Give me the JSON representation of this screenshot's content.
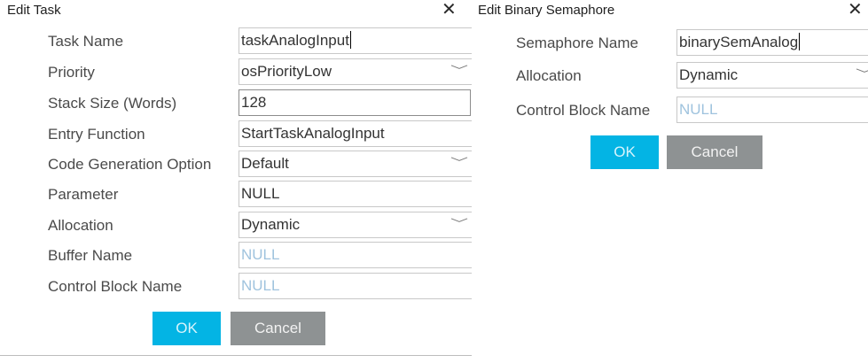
{
  "task_dialog": {
    "title": "Edit Task",
    "close_glyph": "✕",
    "rows": [
      {
        "label": "Task Name",
        "value": "taskAnalogInput",
        "kind": "text-active"
      },
      {
        "label": "Priority",
        "value": "osPriorityLow",
        "kind": "dropdown"
      },
      {
        "label": "Stack Size (Words)",
        "value": "128",
        "kind": "text-boxed"
      },
      {
        "label": "Entry Function",
        "value": "StartTaskAnalogInput",
        "kind": "text"
      },
      {
        "label": "Code Generation Option",
        "value": "Default",
        "kind": "dropdown"
      },
      {
        "label": "Parameter",
        "value": "NULL",
        "kind": "text"
      },
      {
        "label": "Allocation",
        "value": "Dynamic",
        "kind": "dropdown"
      },
      {
        "label": "Buffer Name",
        "placeholder": "NULL",
        "kind": "placeholder"
      },
      {
        "label": "Control Block Name",
        "placeholder": "NULL",
        "kind": "placeholder"
      }
    ],
    "ok_label": "OK",
    "cancel_label": "Cancel"
  },
  "semaphore_dialog": {
    "title": "Edit Binary Semaphore",
    "close_glyph": "✕",
    "rows": [
      {
        "label": "Semaphore Name",
        "value": "binarySemAnalog",
        "kind": "text-active"
      },
      {
        "label": "Allocation",
        "value": "Dynamic",
        "kind": "dropdown"
      },
      {
        "label": "Control Block Name",
        "placeholder": "NULL",
        "kind": "placeholder"
      }
    ],
    "ok_label": "OK",
    "cancel_label": "Cancel"
  },
  "icons": {
    "close": "close-icon",
    "dropdown": "chevron-down-icon"
  },
  "colors": {
    "ok_button": "#03b4e4",
    "cancel_button": "#8e9293",
    "placeholder_text": "#9fc3de"
  }
}
